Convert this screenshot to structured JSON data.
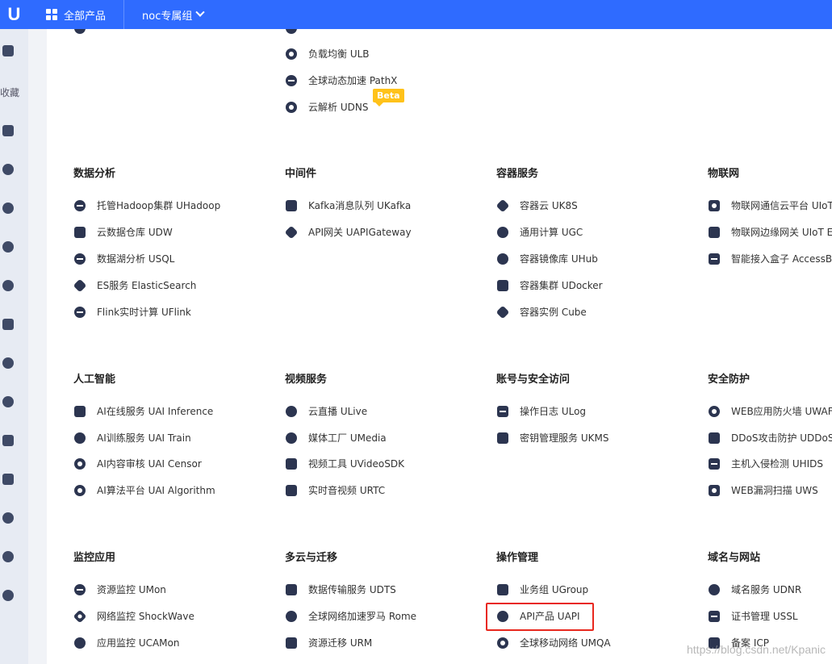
{
  "topbar": {
    "logo": "U",
    "all_products": "全部产品",
    "project": "noc专属组"
  },
  "sidebar": {
    "favorites": "收藏"
  },
  "top_items": [
    {
      "label": "负载均衡 ULB",
      "icon": "load-balance-icon"
    },
    {
      "label": "全球动态加速 PathX",
      "icon": "pathx-icon"
    },
    {
      "label": "云解析 UDNS",
      "icon": "dns-icon",
      "badge": "Beta"
    }
  ],
  "sections": [
    {
      "title": "数据分析",
      "items": [
        "托管Hadoop集群 UHadoop",
        "云数据仓库  UDW",
        "数据湖分析 USQL",
        "ES服务 ElasticSearch",
        "Flink实时计算 UFlink"
      ]
    },
    {
      "title": "中间件",
      "items": [
        "Kafka消息队列 UKafka",
        "API网关 UAPIGateway"
      ]
    },
    {
      "title": "容器服务",
      "items": [
        "容器云 UK8S",
        "通用计算 UGC",
        "容器镜像库 UHub",
        "容器集群 UDocker",
        "容器实例 Cube"
      ]
    },
    {
      "title": "物联网",
      "items": [
        "物联网通信云平台 UIoT",
        "物联网边缘网关 UIoT E",
        "智能接入盒子 AccessB"
      ]
    },
    {
      "title": "人工智能",
      "items": [
        "AI在线服务 UAI Inference",
        "AI训练服务 UAI Train",
        "AI内容审核 UAI Censor",
        "AI算法平台 UAI Algorithm"
      ]
    },
    {
      "title": "视频服务",
      "items": [
        "云直播 ULive",
        "媒体工厂 UMedia",
        "视频工具 UVideoSDK",
        "实时音视频 URTC"
      ]
    },
    {
      "title": "账号与安全访问",
      "items": [
        "操作日志 ULog",
        "密钥管理服务 UKMS"
      ]
    },
    {
      "title": "安全防护",
      "items": [
        "WEB应用防火墙 UWAF",
        "DDoS攻击防护 UDDoS",
        "主机入侵检测 UHIDS",
        "WEB漏洞扫描 UWS"
      ]
    },
    {
      "title": "监控应用",
      "items": [
        "资源监控 UMon",
        "网络监控 ShockWave",
        "应用监控 UCAMon"
      ]
    },
    {
      "title": "多云与迁移",
      "items": [
        "数据传输服务 UDTS",
        "全球网络加速罗马 Rome",
        "资源迁移 URM"
      ]
    },
    {
      "title": "操作管理",
      "items": [
        "业务组 UGroup",
        "API产品 UAPI",
        "全球移动网络 UMQA"
      ]
    },
    {
      "title": "域名与网站",
      "items": [
        "域名服务 UDNR",
        "证书管理 USSL",
        "备案 ICP"
      ]
    }
  ],
  "watermark": "https://blog.csdn.net/Kpanic"
}
